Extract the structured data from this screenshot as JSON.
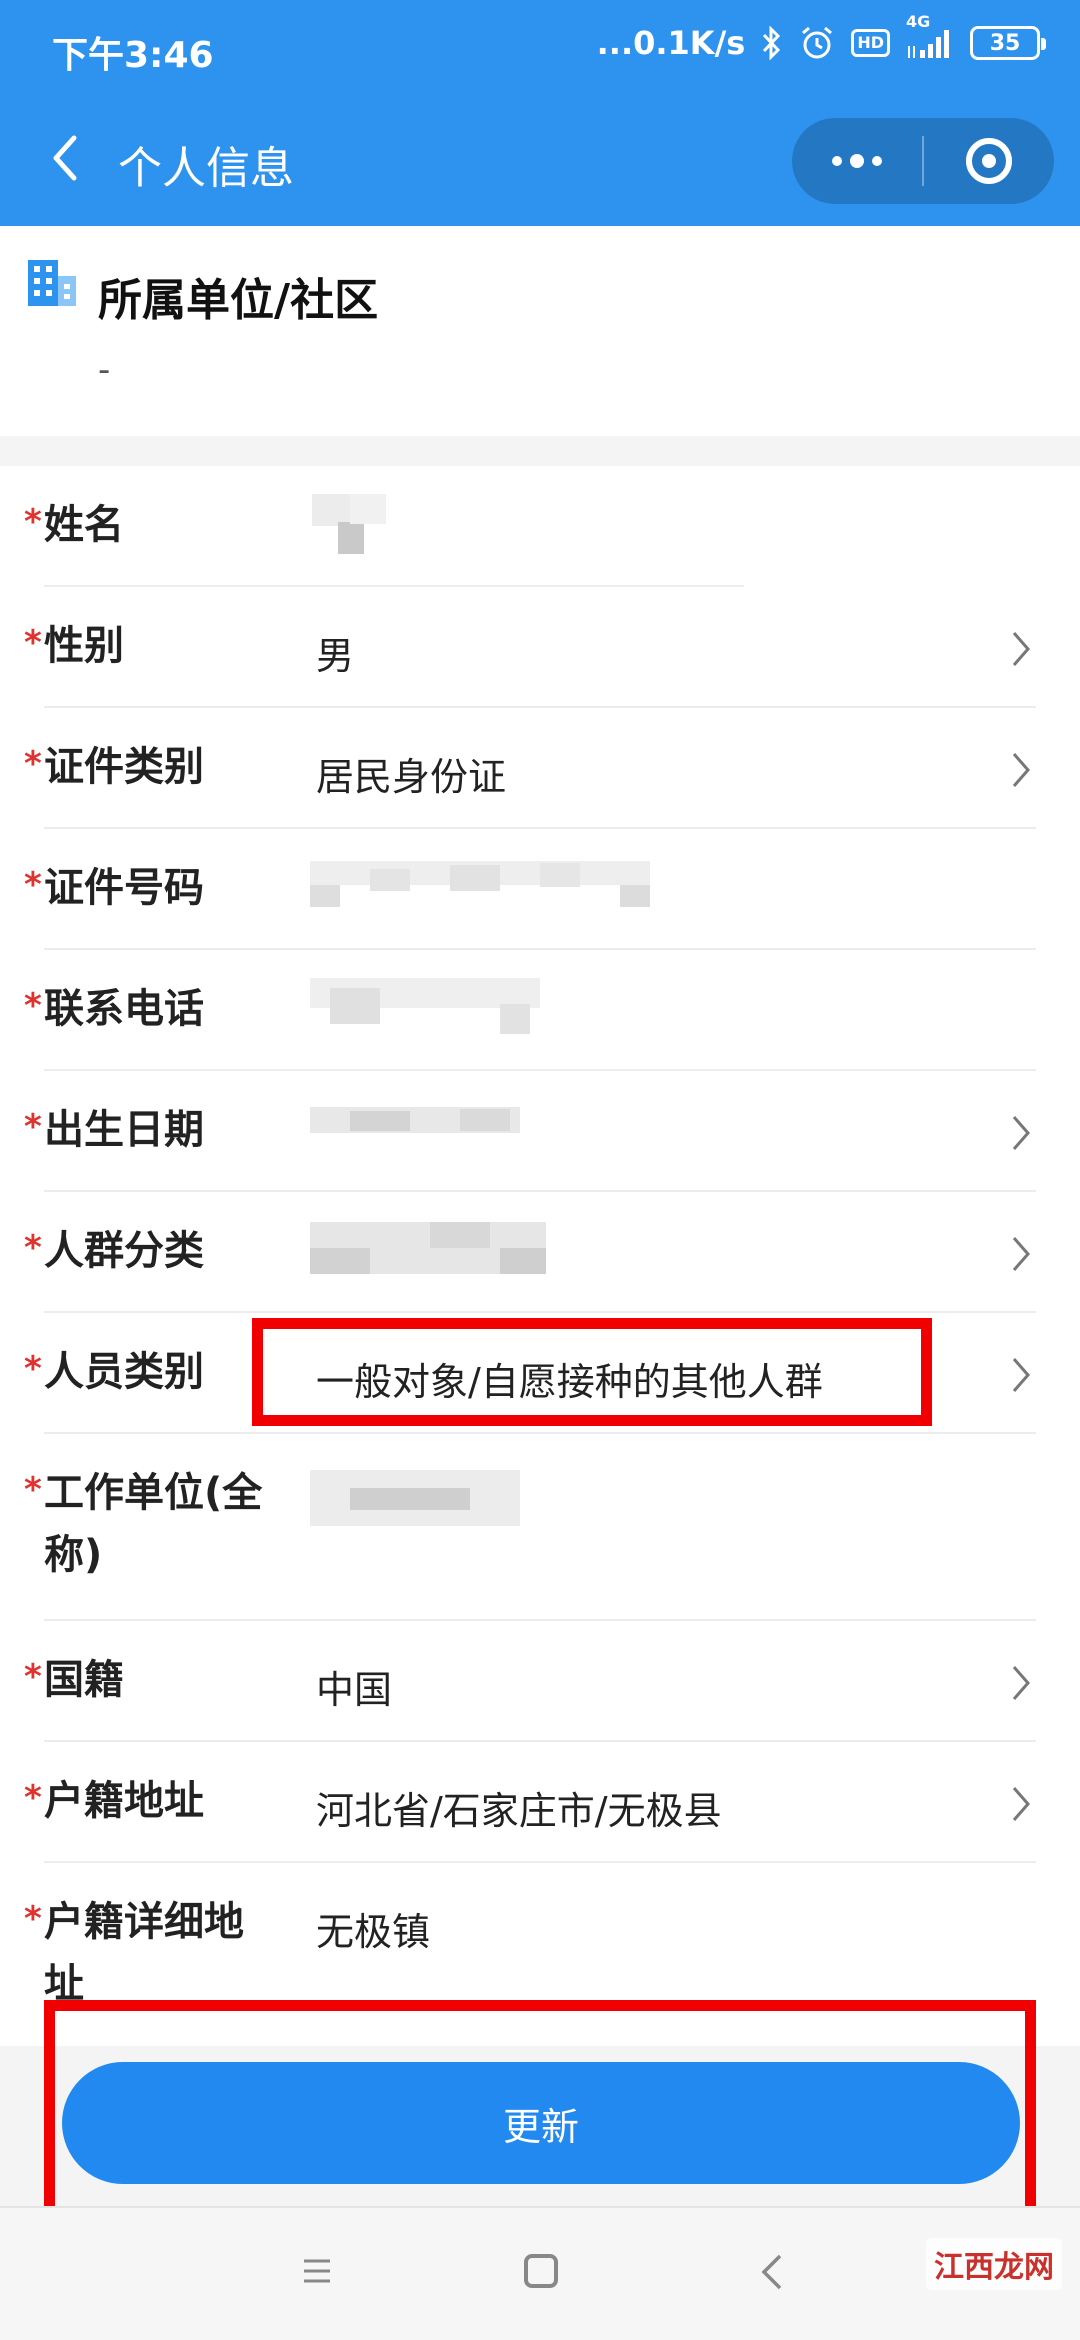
{
  "status_bar": {
    "time": "下午3:46",
    "network_speed": "...0.1K/s",
    "hd_label": "HD",
    "signal_label": "4G",
    "battery": "35"
  },
  "nav": {
    "title": "个人信息"
  },
  "unit": {
    "title": "所属单位/社区",
    "value": "-"
  },
  "form": {
    "required_mark": "*",
    "fields": [
      {
        "label": "姓名",
        "value": ""
      },
      {
        "label": "性别",
        "value": "男"
      },
      {
        "label": "证件类别",
        "value": "居民身份证"
      },
      {
        "label": "证件号码",
        "value": ""
      },
      {
        "label": "联系电话",
        "value": ""
      },
      {
        "label": "出生日期",
        "value": ""
      },
      {
        "label": "人群分类",
        "value": ""
      },
      {
        "label": "人员类别",
        "value": "一般对象/自愿接种的其他人群"
      },
      {
        "label": "工作单位(全称)",
        "value": ""
      },
      {
        "label": "国籍",
        "value": "中国"
      },
      {
        "label": "户籍地址",
        "value": "河北省/石家庄市/无极县"
      },
      {
        "label": "户籍详细地址",
        "value": "无极镇"
      }
    ]
  },
  "actions": {
    "update_label": "更新"
  },
  "watermark": "江西龙网",
  "colors": {
    "primary": "#2d93ee",
    "button": "#2189f0",
    "required": "#e0332f",
    "highlight": "#f00000"
  }
}
